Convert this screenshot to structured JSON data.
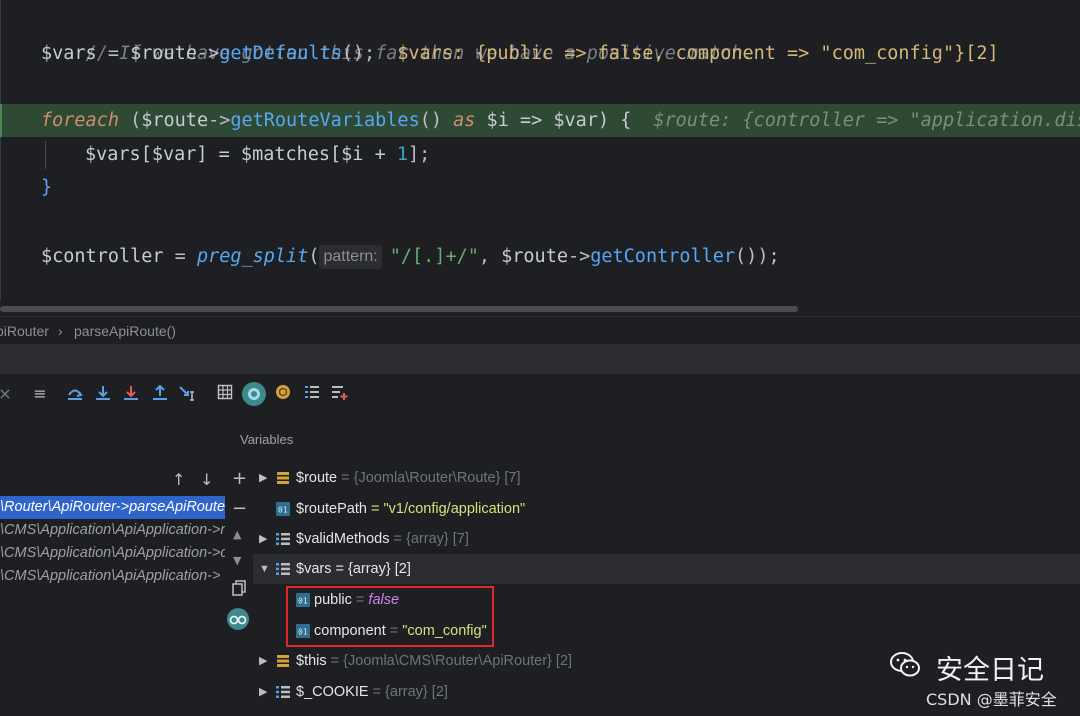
{
  "code": {
    "line1_comment": "// If we have gotten this far then we have a positive match.",
    "line2": {
      "var": "$vars",
      "eq": " = ",
      "obj": "$route",
      "arrow": "->",
      "fn": "getDefaults",
      "tail": "();",
      "inline": "$vars: {public => false, component => \"com_config\"}[2]"
    },
    "line3": {
      "kw": "foreach",
      "open": " (",
      "obj": "$route",
      "arrow": "->",
      "fn": "getRouteVariables",
      "call": "() ",
      "as": "as",
      "mid": " $i => $var) {",
      "inline": "$route: {controller => \"application.disp"
    },
    "line4": {
      "a": "$vars[$var] = $matches[$i + ",
      "num": "1",
      "b": "];"
    },
    "line5": "}",
    "line6": {
      "var": "$controller",
      "eq": " = ",
      "fn": "preg_split",
      "paren": "(",
      "hint": "pattern:",
      "str": "\"/[.]+/\"",
      "comma": ", ",
      "obj": "$route",
      "arrow": "->",
      "fn2": "getController",
      "tail": "());"
    }
  },
  "breadcrumb": {
    "item1": "piRouter",
    "sep": "›",
    "item2": "parseApiRoute()"
  },
  "variables_title": "Variables",
  "frames": [
    "\\Router\\ApiRouter->parseApiRoute(",
    "\\CMS\\Application\\ApiApplication->r",
    "\\CMS\\Application\\ApiApplication->c",
    "\\CMS\\Application\\ApiApplication->"
  ],
  "vars": [
    {
      "name": "$route",
      "value": " = {Joomla\\Router\\Route} [7]"
    },
    {
      "name": "$routePath",
      "value": " = \"v1/config/application\""
    },
    {
      "name": "$validMethods",
      "value": " = {array} [7]"
    },
    {
      "name": "$vars",
      "value": " = {array} [2]"
    },
    {
      "name": "public",
      "eq": " = ",
      "value": "false"
    },
    {
      "name": "component",
      "eq": " = ",
      "value": "\"com_config\""
    },
    {
      "name": "$this",
      "value": " = {Joomla\\CMS\\Router\\ApiRouter} [2]"
    },
    {
      "name": "$_COOKIE",
      "value": " = {array} [2]"
    }
  ],
  "watermark": {
    "title": "安全日记",
    "sub": "CSDN @墨菲安全"
  },
  "colors": {
    "selection": "#2f65ca",
    "highlight_row": "#2e4a34",
    "red_box": "#e0252d"
  }
}
